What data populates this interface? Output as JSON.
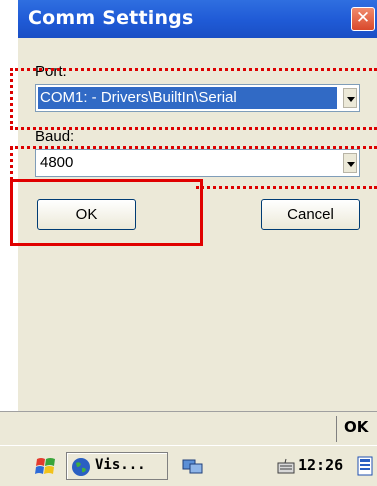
{
  "window": {
    "title": "Comm Settings",
    "close_glyph": "✕"
  },
  "port": {
    "label": "Port:",
    "selected": "COM1: - Drivers\\BuiltIn\\Serial"
  },
  "baud": {
    "label": "Baud:",
    "selected": "4800"
  },
  "buttons": {
    "ok": "OK",
    "cancel": "Cancel"
  },
  "softkey": {
    "right": "OK"
  },
  "taskbar": {
    "task_label": "Vis...",
    "clock": "12:26"
  },
  "colors": {
    "titlebar": "#1f5ad6",
    "selection": "#316ac5",
    "annotation_red": "#dd0000",
    "dialog_bg": "#ece9d8"
  },
  "icons": [
    "close-icon",
    "dropdown-arrow-icon",
    "windows-start-icon",
    "globe-icon",
    "network-icon",
    "keyboard-icon",
    "desktop-icon"
  ]
}
